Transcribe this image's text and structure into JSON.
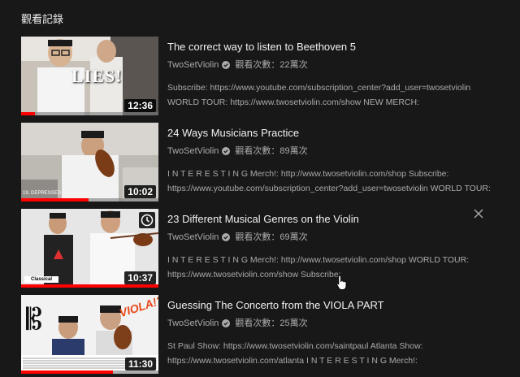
{
  "page": {
    "title": "觀看記錄"
  },
  "colors": {
    "accent": "#ff0000",
    "background": "#181818",
    "secondary_text": "#aaaaaa"
  },
  "videos": [
    {
      "title": "The correct way to listen to Beethoven 5",
      "channel": "TwoSetViolin",
      "views": "觀看次數：22萬次",
      "desc_line1": "Subscribe: https://www.youtube.com/subscription_center?add_user=twosetviolin",
      "desc_line2": "WORLD TOUR: https://www.twosetviolin.com/show NEW MERCH:",
      "duration": "12:36",
      "thumb_text": "LIES!",
      "watched_fraction": 0.1
    },
    {
      "title": "24 Ways Musicians Practice",
      "channel": "TwoSetViolin",
      "views": "觀看次數：89萬次",
      "desc_line1": "I N T E R E S T I N G Merch!: http://www.twosetviolin.com/shop Subscribe:",
      "desc_line2": "https://www.youtube.com/subscription_center?add_user=twosetviolin WORLD TOUR:",
      "duration": "10:02",
      "thumb_text": "19. DEPRESSED",
      "watched_fraction": 0.49
    },
    {
      "title": "23 Different Musical Genres on the Violin",
      "channel": "TwoSetViolin",
      "views": "觀看次數：69萬次",
      "desc_line1": "I N T E R E S T I N G Merch!: http://www.twosetviolin.com/shop WORLD TOUR:",
      "desc_line2": "https://www.twosetviolin.com/show Subscribe:",
      "duration": "10:37",
      "thumb_text": "Classical",
      "watched_fraction": 1.0
    },
    {
      "title": "Guessing The Concerto from the VIOLA PART",
      "channel": "TwoSetViolin",
      "views": "觀看次數：25萬次",
      "desc_line1": "St Paul Show: https://www.twosetviolin.com/saintpaul Atlanta Show:",
      "desc_line2": "https://www.twosetviolin.com/atlanta I N T E R E S T I N G Merch!:",
      "duration": "11:30",
      "thumb_text": "VIOLA!?",
      "watched_fraction": 0.67
    }
  ],
  "icons": {
    "verified": "check-circle-icon",
    "dismiss": "close-icon",
    "watch_later": "clock-icon"
  }
}
